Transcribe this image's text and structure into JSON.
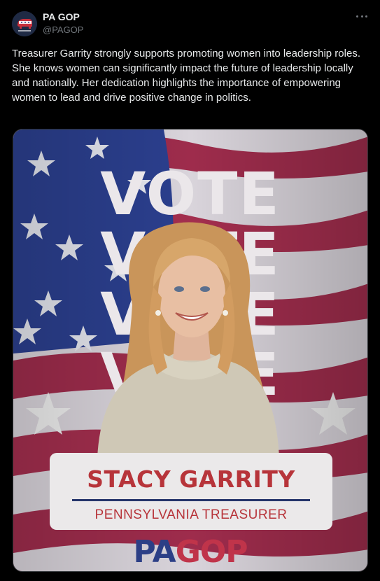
{
  "account": {
    "name": "PA GOP",
    "handle": "@PAGOP",
    "avatar_icon": "gop-elephant-logo-icon"
  },
  "post": {
    "text": "Treasurer Garrity strongly supports promoting women into leadership roles. She knows women can significantly impact the future of leadership locally and nationally. Her dedication highlights the importance of empowering women to lead and drive positive change in politics."
  },
  "media": {
    "vote_words": [
      "VOTE",
      "VOTE",
      "VOTE",
      "VOTE"
    ],
    "candidate_name": "STACY GARRITY",
    "candidate_title": "PENNSYLVANIA TREASURER",
    "logo_pa": "PA",
    "logo_gop": "GOP",
    "colors": {
      "name_red": "#b7343a",
      "divider_navy": "#25356b",
      "flag_blue": "#2b3f8e",
      "flag_red": "#9e2c4c"
    }
  },
  "icons": {
    "more": "more-horizontal-icon"
  }
}
